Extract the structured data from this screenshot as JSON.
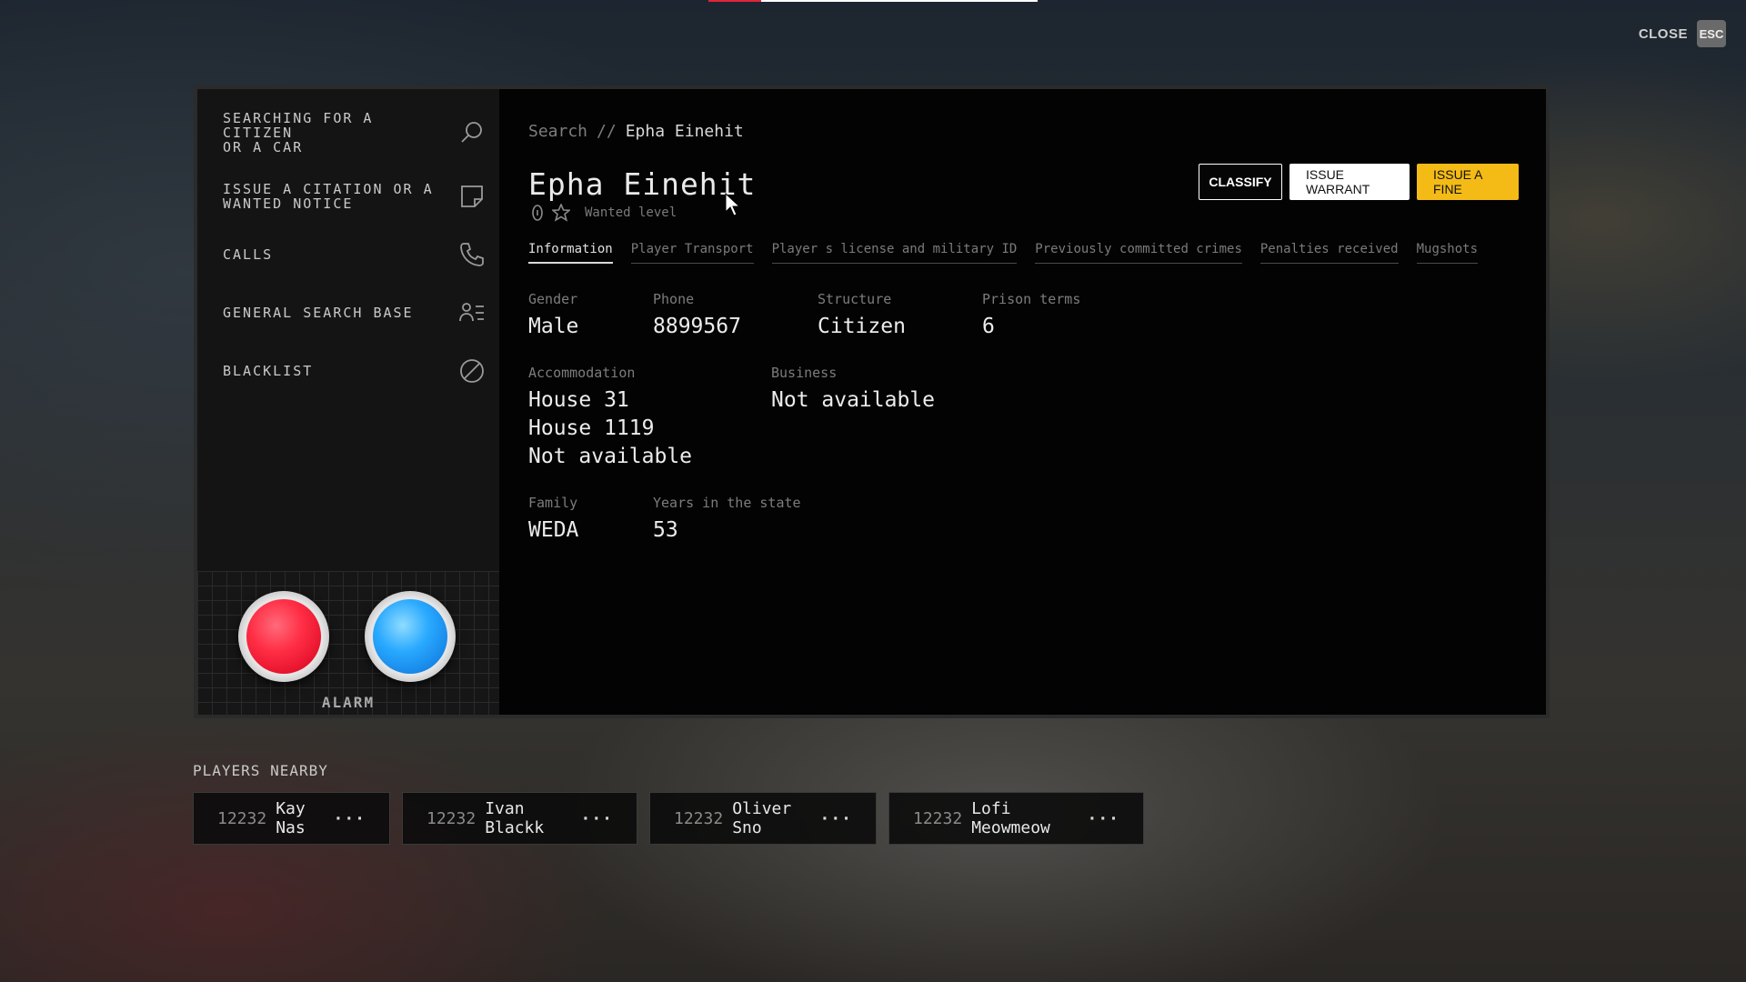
{
  "top_bar": {
    "progress": 0.16,
    "fill_color": "#e0243a"
  },
  "close": {
    "label": "CLOSE",
    "key": "ESC"
  },
  "sidebar": {
    "items": [
      {
        "label": "SEARCHING FOR A\nCITIZEN\nOR A CAR",
        "icon": "search-icon"
      },
      {
        "label": "ISSUE A CITATION OR A\nWANTED NOTICE",
        "icon": "note-icon"
      },
      {
        "label": "CALLS",
        "icon": "phone-icon"
      },
      {
        "label": "GENERAL SEARCH BASE",
        "icon": "people-list-icon"
      },
      {
        "label": "BLACKLIST",
        "icon": "block-icon"
      }
    ],
    "alarm_label": "ALARM"
  },
  "breadcrumb": {
    "root": "Search",
    "separator": "//",
    "current": "Epha Einehit"
  },
  "citizen": {
    "name": "Epha Einehit",
    "wanted_count": "0",
    "wanted_label": "Wanted level"
  },
  "actions": {
    "classify": "CLASSIFY",
    "warrant": "ISSUE WARRANT",
    "fine": "ISSUE A FINE",
    "fine_color": "#f4bb17"
  },
  "tabs": [
    "Information",
    "Player Transport",
    "Player s license and military ID",
    "Previously committed crimes",
    "Penalties received",
    "Mugshots"
  ],
  "info": {
    "gender": {
      "label": "Gender",
      "value": "Male"
    },
    "phone": {
      "label": "Phone",
      "value": "8899567"
    },
    "structure": {
      "label": "Structure",
      "value": "Citizen"
    },
    "prison": {
      "label": "Prison terms",
      "value": "6"
    },
    "accommodation": {
      "label": "Accommodation",
      "values": [
        "House 31",
        "House 1119",
        "Not available"
      ]
    },
    "business": {
      "label": "Business",
      "value": "Not available"
    },
    "family": {
      "label": "Family",
      "value": "WEDA"
    },
    "years": {
      "label": "Years in the state",
      "value": "53"
    }
  },
  "nearby": {
    "title": "PLAYERS NEARBY",
    "players": [
      {
        "id": "12232",
        "name": "Kay Nas"
      },
      {
        "id": "12232",
        "name": "Ivan Blackk"
      },
      {
        "id": "12232",
        "name": "Oliver Sno"
      },
      {
        "id": "12232",
        "name": "Lofi Meowmeow"
      }
    ],
    "more": "···"
  }
}
